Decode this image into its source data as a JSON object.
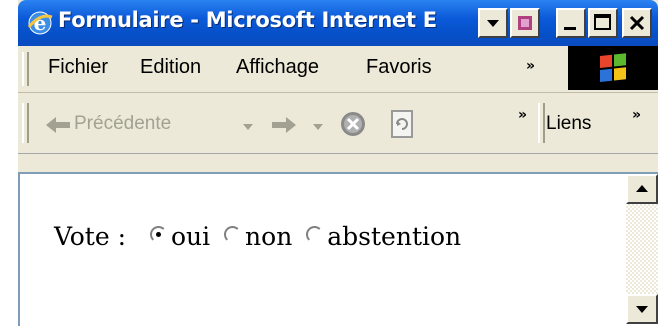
{
  "window": {
    "title": "Formulaire - Microsoft Internet E",
    "title_bar_color": "#0b5ad9"
  },
  "menu": {
    "items": [
      "Fichier",
      "Edition",
      "Affichage",
      "Favoris"
    ],
    "overflow": "»"
  },
  "toolbar": {
    "back_label": "Précédente",
    "overflow": "»",
    "links_label": "Liens",
    "links_overflow": "»"
  },
  "form": {
    "label": "Vote :",
    "options": [
      {
        "label": "oui",
        "checked": true
      },
      {
        "label": "non",
        "checked": false
      },
      {
        "label": "abstention",
        "checked": false
      }
    ]
  }
}
